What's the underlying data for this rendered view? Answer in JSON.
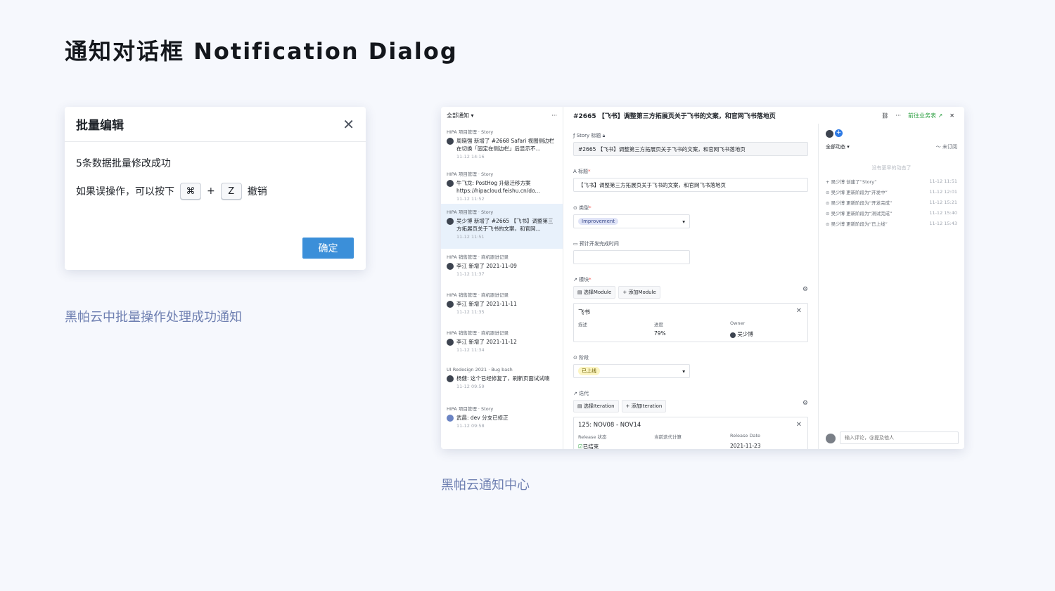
{
  "page_title": "通知对话框 Notification Dialog",
  "dialog": {
    "title": "批量编辑",
    "close_icon": "✕",
    "message": "5条数据批量修改成功",
    "undo_prefix": "如果误操作，可以按下",
    "key_cmd": "⌘",
    "plus": "+",
    "key_z": "Z",
    "undo_suffix": "撤销",
    "confirm_label": "确定",
    "caption": "黑帕云中批量操作处理成功通知"
  },
  "app": {
    "caption": "黑帕云通知中心",
    "filter_label": "全部通知",
    "more_icon": "···",
    "notifications": [
      {
        "source": "HIPA 项目管理 · Story",
        "text": "周晓强 新增了 #2668 Safari 视图侧边栏 在切换「固定在侧边栏」后显示不...",
        "time": "11-12 14:16"
      },
      {
        "source": "HIPA 项目管理 · Story",
        "text": "牛飞龙: PostHog 升级迁移方案 https://hipacloud.feishu.cn/do...",
        "time": "11-12 11:52"
      },
      {
        "source": "HIPA 项目管理 · Story",
        "text": "吴少博 新增了 #2665 【飞书】调整第三方拓展页关于飞书的文案，和官网...",
        "time": "11-12 11:51"
      },
      {
        "source": "HIPA 销售管理 · 商机跟进记录",
        "text": "李江 新增了 2021-11-09",
        "time": "11-12 11:37"
      },
      {
        "source": "HIPA 销售管理 · 商机跟进记录",
        "text": "李江 新增了 2021-11-11",
        "time": "11-12 11:35"
      },
      {
        "source": "HIPA 销售管理 · 商机跟进记录",
        "text": "李江 新增了 2021-11-12",
        "time": "11-12 11:34"
      },
      {
        "source": "UI Redesign 2021 · Bug bash",
        "text": "杨健: 这个已经修复了，刷新页面试试喃",
        "time": "11-12 09:59"
      },
      {
        "source": "HIPA 项目管理 · Story",
        "text": "武晨: dev 分支已修正",
        "time": "11-12 09:58"
      }
    ],
    "detail": {
      "title": "#2665 【飞书】调整第三方拓展页关于飞书的文案，和官网飞书落地页",
      "link_icon": "🔗",
      "goto_label": "前往业务表 ↗",
      "close_icon": "✕",
      "story_title_label": "Story 标题",
      "story_title_value": "#2665 【飞书】调整第三方拓展页关于飞书的文案，和官网飞书落地页",
      "title_label": "标题",
      "title_value": "【飞书】调整第三方拓展页关于飞书的文案，和官网飞书落地页",
      "type_label": "类型",
      "type_value": "Improvement",
      "eta_label": "预计开发完成时间",
      "module_label": "模块",
      "select_module": "选择Module",
      "add_module": "添加Module",
      "module_card": {
        "name": "飞书",
        "col1": "描述",
        "col2": "进度",
        "col3": "Owner",
        "progress": "79%",
        "owner": "吴少博"
      },
      "stage_label": "阶段",
      "stage_value": "已上线",
      "iteration_label": "迭代",
      "select_iteration": "选择Iteration",
      "add_iteration": "添加Iteration",
      "iteration_card": {
        "name": "125: NOV08 - NOV14",
        "col1": "Release 状态",
        "col2": "当前迭代计算",
        "col3": "Release Date",
        "status": "已结束",
        "date": "2021-11-23"
      }
    },
    "activity": {
      "filter_label": "全部动态",
      "subscribe_label": "未订阅",
      "no_more": "没有更早的动态了",
      "items": [
        {
          "text": "吴少博 创建了“Story”",
          "time": "11-12 11:51"
        },
        {
          "text": "吴少博 更新阶段为“开发中”",
          "time": "11-12 12:01"
        },
        {
          "text": "吴少博 更新阶段为“开发完成”",
          "time": "11-12 15:21"
        },
        {
          "text": "吴少博 更新阶段为“测试完成”",
          "time": "11-12 15:40"
        },
        {
          "text": "吴少博 更新阶段为“已上线”",
          "time": "11-12 15:43"
        }
      ],
      "comment_placeholder": "输入评论，@提及他人"
    }
  }
}
